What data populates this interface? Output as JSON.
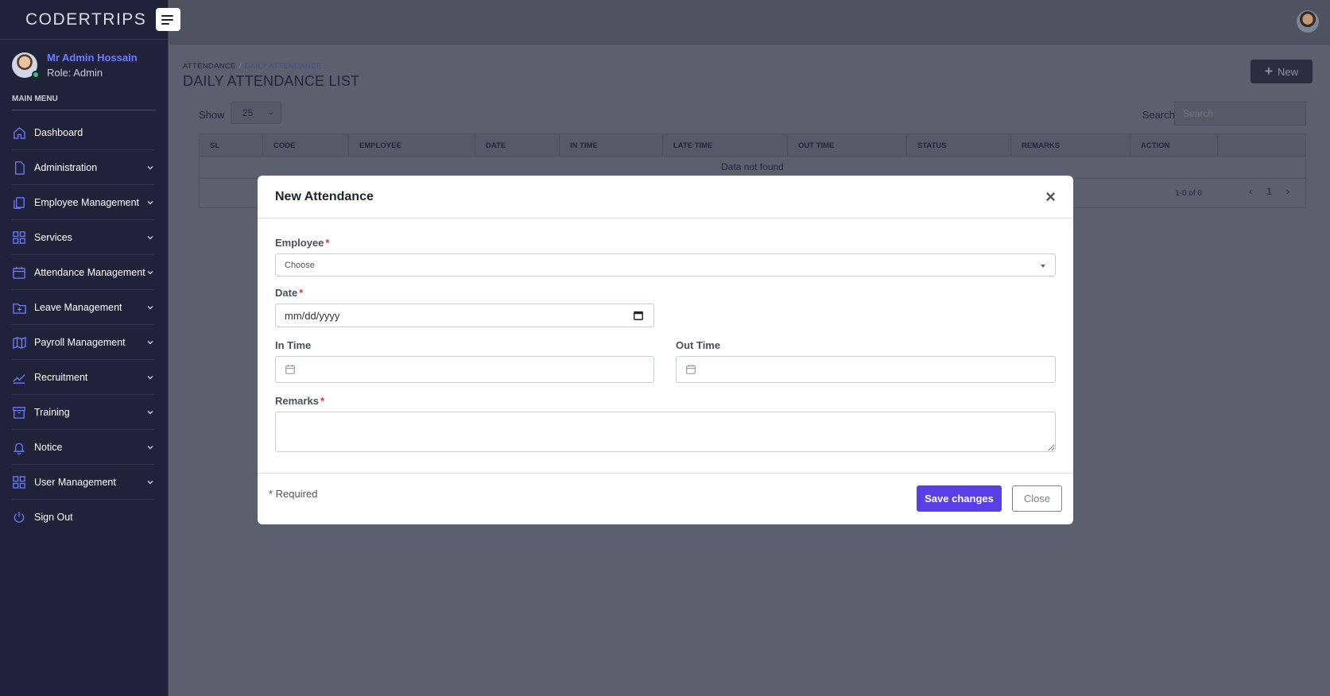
{
  "brand": "CODERTRIPS",
  "user": {
    "name": "Mr Admin Hossain",
    "role": "Role: Admin"
  },
  "menu_heading": "MAIN MENU",
  "menu": [
    {
      "label": "Dashboard",
      "icon": "home-icon",
      "has_children": false
    },
    {
      "label": "Administration",
      "icon": "file-icon",
      "has_children": true
    },
    {
      "label": "Employee Management",
      "icon": "copy-icon",
      "has_children": true
    },
    {
      "label": "Services",
      "icon": "grid-icon",
      "has_children": true
    },
    {
      "label": "Attendance Management",
      "icon": "calendar-icon",
      "has_children": true
    },
    {
      "label": "Leave Management",
      "icon": "folder-plus-icon",
      "has_children": true
    },
    {
      "label": "Payroll Management",
      "icon": "map-icon",
      "has_children": true
    },
    {
      "label": "Recruitment",
      "icon": "trending-up-icon",
      "has_children": true
    },
    {
      "label": "Training",
      "icon": "archive-icon",
      "has_children": true
    },
    {
      "label": "Notice",
      "icon": "bell-icon",
      "has_children": true
    },
    {
      "label": "User Management",
      "icon": "grid-icon",
      "has_children": true
    },
    {
      "label": "Sign Out",
      "icon": "power-icon",
      "has_children": false
    }
  ],
  "breadcrumb": {
    "parent": "ATTENDANCE",
    "separator": "/",
    "current": "DAILY ATTENDANCE"
  },
  "page_title": "DAILY ATTENDANCE LIST",
  "new_button": "New",
  "table": {
    "show_label": "Show",
    "page_size": "25",
    "search_label": "Search",
    "search_placeholder": "Search",
    "columns": [
      "SL",
      "CODE",
      "EMPLOYEE",
      "DATE",
      "IN TIME",
      "LATE TIME",
      "OUT TIME",
      "STATUS",
      "REMARKS",
      "ACTION"
    ],
    "empty_text": "Data not found",
    "pagination_info": "1-0 of 0",
    "current_page": "1"
  },
  "modal": {
    "title": "New Attendance",
    "employee_label": "Employee",
    "employee_value": "Choose",
    "date_label": "Date",
    "date_placeholder": "mm/dd/yyyy",
    "in_time_label": "In Time",
    "out_time_label": "Out Time",
    "remarks_label": "Remarks",
    "required_mark": "*",
    "required_note": "* Required",
    "save_label": "Save changes",
    "close_label": "Close"
  },
  "colors": {
    "accent": "#5a3fe6",
    "sidebar": "#20223a",
    "link": "#6b7cff",
    "required": "#e3342f"
  }
}
